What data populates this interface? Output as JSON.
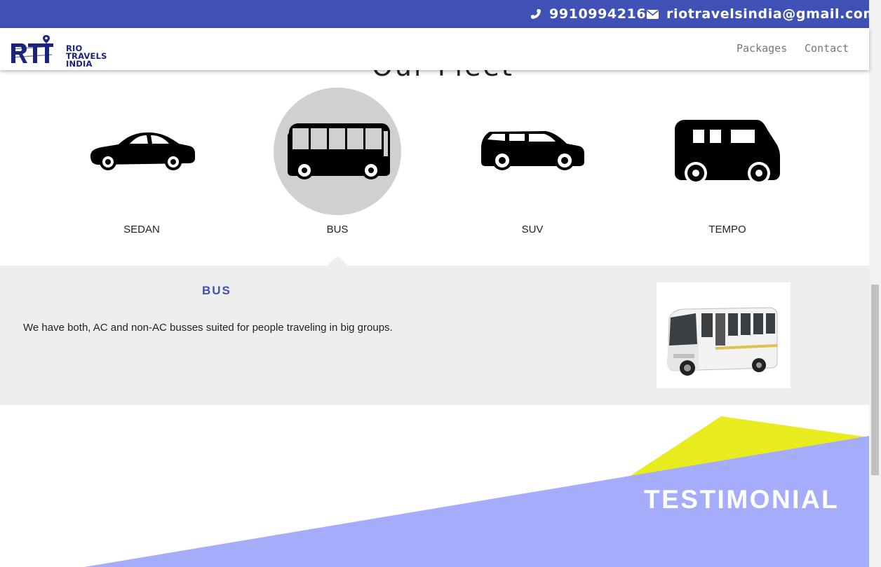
{
  "topbar": {
    "phone": "9910994216",
    "email": "riotravelsindia@gmail.com",
    "phone_icon": "phone-icon",
    "email_icon": "envelope-icon"
  },
  "navbar": {
    "logo": {
      "line1": "RIO",
      "line2": "TRAVELS",
      "line3": "INDIA"
    },
    "links": [
      "Packages",
      "Contact"
    ]
  },
  "fleet": {
    "items": [
      {
        "label": "SEDAN",
        "icon": "sedan-car-icon",
        "active": false
      },
      {
        "label": "BUS",
        "icon": "bus-icon",
        "active": true
      },
      {
        "label": "SUV",
        "icon": "suv-car-icon",
        "active": false
      },
      {
        "label": "TEMPO",
        "icon": "tempo-van-icon",
        "active": false
      }
    ]
  },
  "detail": {
    "title": "BUS",
    "description": "We have both, AC and non-AC busses suited for people traveling in big groups."
  },
  "testimonial": {
    "title": "TESTIMONIAL"
  },
  "colors": {
    "brand": "#3f51b5",
    "active_circle": "#d0d0d0",
    "panel_bg": "#eeeeee",
    "testimonial_blue": "#a5acfa",
    "testimonial_yellow": "#e8ec1e"
  }
}
